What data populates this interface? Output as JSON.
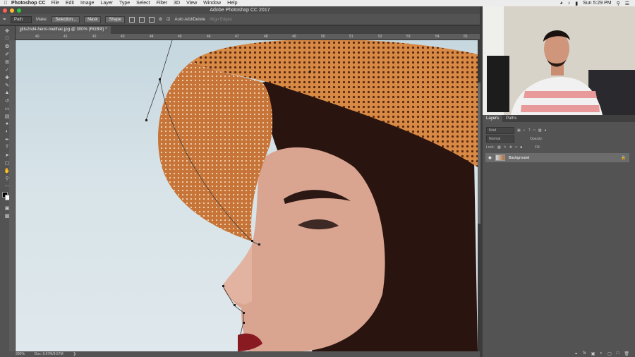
{
  "macmenu": {
    "app_name": "Photoshop CC",
    "items": [
      "File",
      "Edit",
      "Image",
      "Layer",
      "Type",
      "Select",
      "Filter",
      "3D",
      "View",
      "Window",
      "Help"
    ],
    "clock": "Sun 5:29 PM"
  },
  "window": {
    "title": "Adobe Photoshop CC 2017"
  },
  "options": {
    "mode": "Path",
    "make_label": "Make:",
    "selection": "Selection...",
    "mask": "Mask",
    "shape": "Shape",
    "auto_add": "Auto Add/Delete",
    "align_edges": "Align Edges"
  },
  "document": {
    "tab": "jjitls2nd4-henri-meilhac.jpg @ 300% (RGB/8) *",
    "zoom": "300%",
    "doc_size": "Doc: 9.67M/9.67M"
  },
  "ruler": {
    "ticks": [
      "40",
      "41",
      "42",
      "43",
      "44",
      "45",
      "46",
      "47",
      "48",
      "49",
      "50",
      "51",
      "52",
      "53",
      "54",
      "55"
    ]
  },
  "tools": [
    "move",
    "marquee",
    "lasso",
    "quick-select",
    "crop",
    "eyedropper",
    "healing",
    "brush",
    "stamp",
    "history",
    "eraser",
    "gradient",
    "blur",
    "dodge",
    "pen",
    "type",
    "path-select",
    "shape",
    "hand",
    "zoom",
    "more"
  ],
  "layers_panel": {
    "tabs": [
      "Layers",
      "Paths"
    ],
    "kind_label": "Kind",
    "blend_mode": "Normal",
    "opacity_label": "Opacity:",
    "lock_label": "Lock:",
    "fill_label": "Fill:",
    "layers": [
      {
        "name": "Background"
      }
    ]
  }
}
